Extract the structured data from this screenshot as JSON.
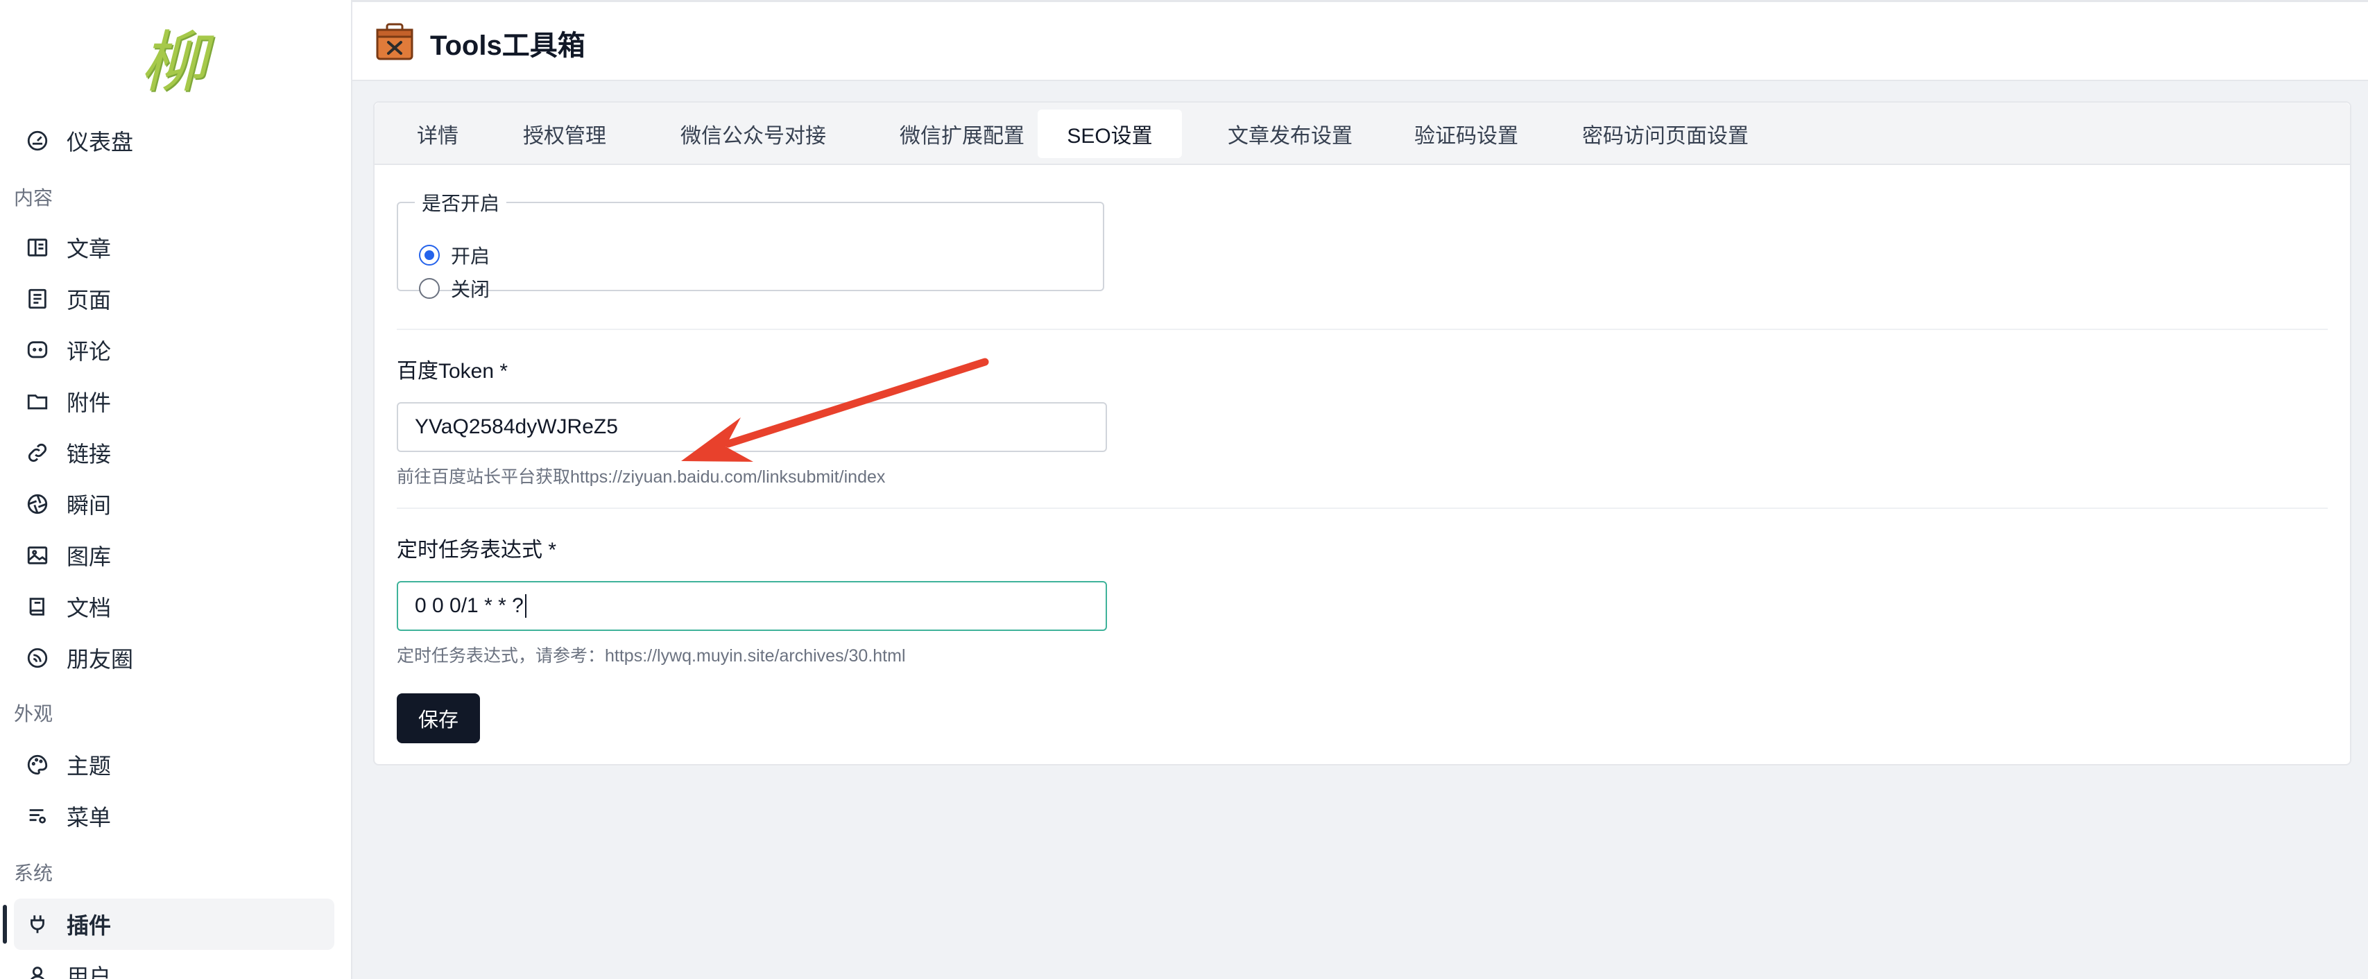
{
  "app": {
    "logo_text": "柳",
    "title": "Tools工具箱"
  },
  "sidebar": {
    "dashboard": "仪表盘",
    "sections": {
      "content": "内容",
      "appearance": "外观",
      "system": "系统"
    },
    "items": {
      "posts": "文章",
      "pages": "页面",
      "comments": "评论",
      "attachments": "附件",
      "links": "链接",
      "moments": "瞬间",
      "photos": "图库",
      "docs": "文档",
      "friends": "朋友圈",
      "themes": "主题",
      "menus": "菜单",
      "plugins": "插件",
      "users": "用户"
    },
    "active_item": "插件"
  },
  "tabs": [
    "详情",
    "授权管理",
    "微信公众号对接",
    "微信扩展配置",
    "SEO设置",
    "文章发布设置",
    "验证码设置",
    "密码访问页面设置"
  ],
  "active_tab": "SEO设置",
  "form": {
    "enable": {
      "legend": "是否开启",
      "options": [
        "开启",
        "关闭"
      ],
      "selected": "开启"
    },
    "baidu_token": {
      "label": "百度Token *",
      "value": "YVaQ2584dyWJReZ5",
      "help": "前往百度站长平台获取https://ziyuan.baidu.com/linksubmit/index"
    },
    "cron": {
      "label": "定时任务表达式 *",
      "value": "0 0 0/1 * * ?",
      "help": "定时任务表达式，请参考：https://lywq.muyin.site/archives/30.html"
    },
    "save_label": "保存"
  },
  "colors": {
    "accent": "#2563eb",
    "focus_border": "#3fb39a",
    "button_bg": "#111827",
    "annotation_arrow": "#e8412c"
  }
}
